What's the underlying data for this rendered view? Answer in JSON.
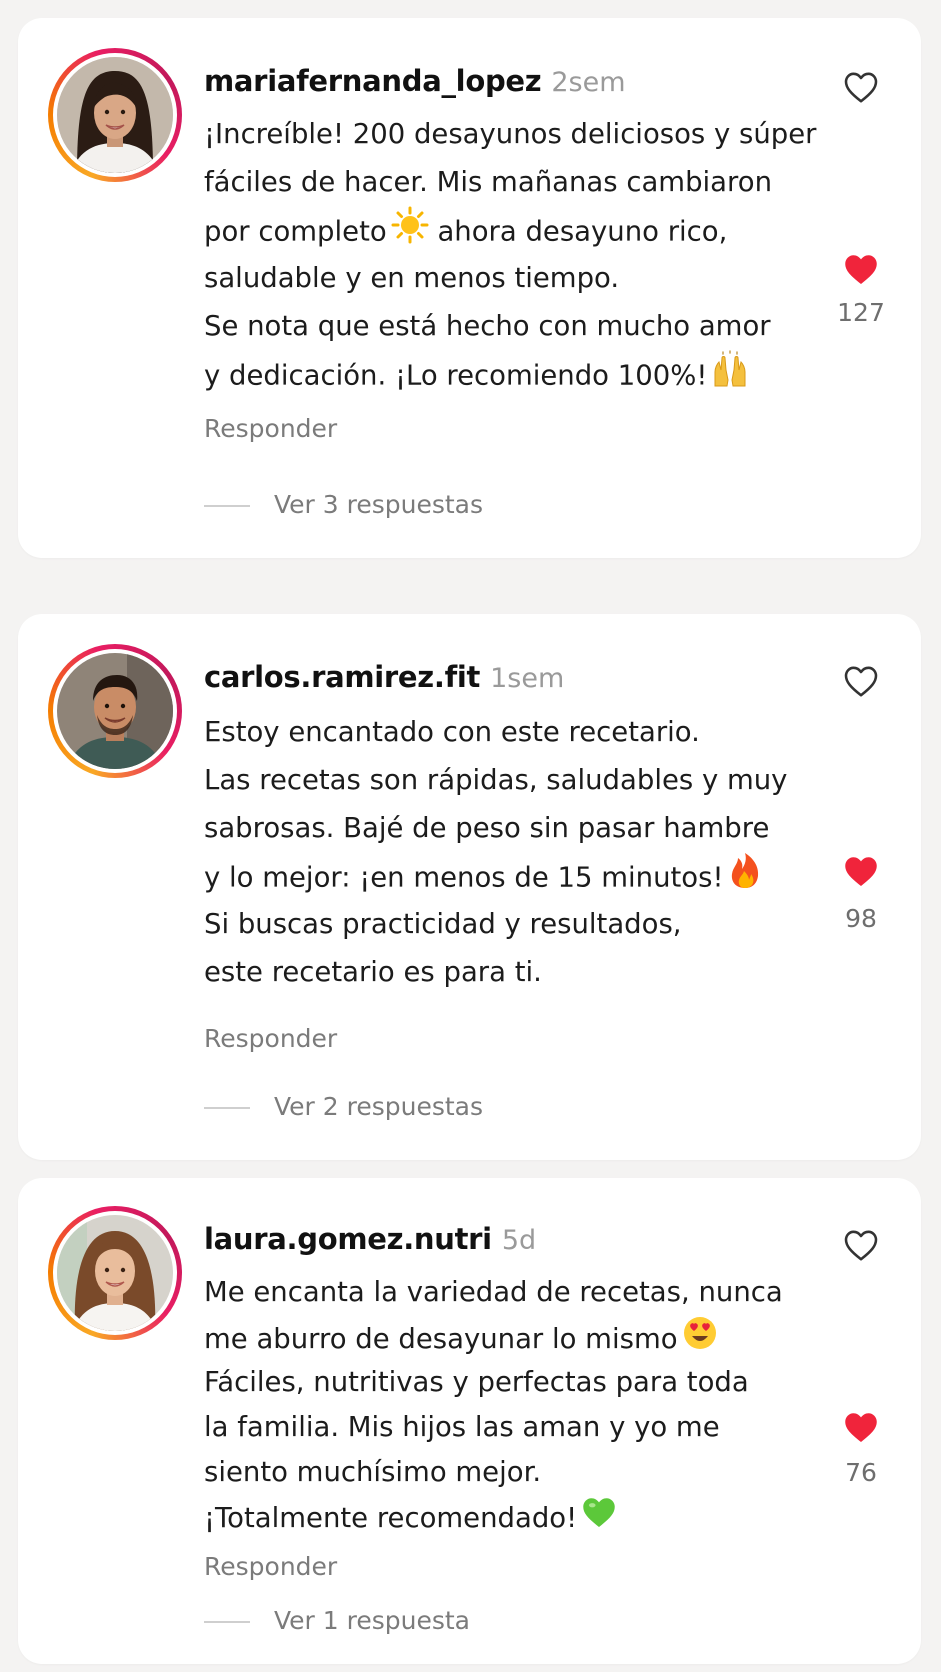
{
  "comments": [
    {
      "username": "mariafernanda_lopez",
      "time": "2sem",
      "lines": [
        "¡Increíble! 200 desayunos deliciosos y súper",
        "fáciles de hacer. Mis mañanas cambiaron",
        "por completo",
        "ahora desayuno rico,",
        "saludable y en menos tiempo.",
        "Se nota que está hecho con mucho amor",
        "y dedicación. ¡Lo recomiendo 100%!"
      ],
      "likes": "127",
      "reply_label": "Responder",
      "view_replies": "Ver 3 respuestas"
    },
    {
      "username": "carlos.ramirez.fit",
      "time": "1sem",
      "lines": [
        "Estoy encantado con este recetario.",
        "Las recetas son rápidas, saludables y muy",
        "sabrosas. Bajé de peso sin pasar hambre",
        "y lo mejor: ¡en menos de 15 minutos!",
        "Si buscas practicidad y resultados,",
        "este recetario es para ti."
      ],
      "likes": "98",
      "reply_label": "Responder",
      "view_replies": "Ver 2 respuestas"
    },
    {
      "username": "laura.gomez.nutri",
      "time": "5d",
      "lines": [
        "Me encanta la variedad de recetas, nunca",
        "me aburro de desayunar lo mismo",
        "Fáciles, nutritivas y perfectas para toda",
        "la familia. Mis hijos las aman y yo me",
        "siento muchísimo mejor.",
        "¡Totalmente recomendado!"
      ],
      "likes": "76",
      "reply_label": "Responder",
      "view_replies": "Ver 1 respuesta"
    }
  ],
  "colors": {
    "heart_filled": "#f0243b",
    "heart_outline": "#333333",
    "avatar_ring": [
      "#f9a825",
      "#e91e63"
    ],
    "muted_text": "#7b7b7b"
  },
  "icons": {
    "like_outline": "heart-outline-icon",
    "like_filled": "heart-filled-icon",
    "emoji_1": "sun-emoji-icon",
    "emoji_2": "raised-hands-emoji-icon",
    "emoji_3": "fire-emoji-icon",
    "emoji_4": "heart-eyes-emoji-icon",
    "emoji_5": "green-heart-emoji-icon"
  }
}
